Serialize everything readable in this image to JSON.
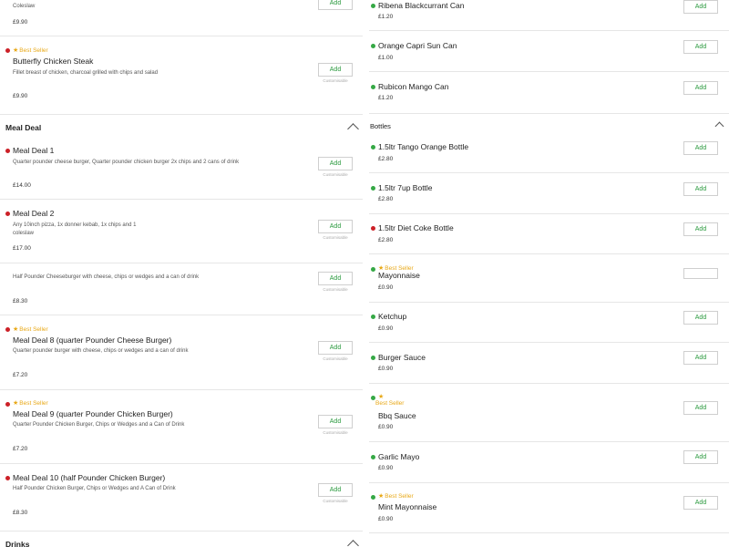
{
  "colors": {
    "veg": "#35a845",
    "nonveg": "#cc2027",
    "bestseller": "#e8a817",
    "add": "#2b9a3f"
  },
  "common": {
    "add_label": "Add",
    "customisable_label": "Customisable",
    "best_seller_label": "Best Seller"
  },
  "left": {
    "top_item": {
      "desc": "Coleslaw",
      "price": "£9.90"
    },
    "butterfly": {
      "name": "Butterfly Chicken Steak",
      "desc": "Fillet breast of chicken, charcoal grilled with chips and salad",
      "price": "£9.90"
    },
    "meal_deal_section": "Meal Deal",
    "meal_deals": [
      {
        "name": "Meal Deal 1",
        "desc": "Quarter pounder cheese burger, Quarter pounder chicken burger 2x chips and 2 cans of drink",
        "price": "£14.00"
      },
      {
        "name": "Meal Deal 2",
        "desc": "Any 10inch pizza, 1x donner kebab, 1x chips and 1 coleslaw",
        "price": "£17.00"
      },
      {
        "name": "",
        "desc": "Half Pounder Cheeseburger with cheese, chips or wedges and a can of drink",
        "price": "£8.30"
      },
      {
        "name": "Meal Deal 8 (quarter Pounder Cheese Burger)",
        "desc": "Quarter pounder burger with cheese, chips or wedges and a can of drink",
        "price": "£7.20"
      },
      {
        "name": "Meal Deal 9 (quarter Pounder Chicken Burger)",
        "desc": "Quarter Pounder Chicken Burger, Chips or Wedges and a Can of Drink",
        "price": "£7.20"
      },
      {
        "name": "Meal Deal 10 (half Pounder Chicken Burger)",
        "desc": "Half Pounder Chicken Burger, Chips or Wedges and A Can of Drink",
        "price": "£8.30"
      }
    ],
    "drinks_section": "Drinks"
  },
  "right": {
    "cans": [
      {
        "name": "Ribena Blackcurrant Can",
        "price": "£1.20"
      },
      {
        "name": "Orange Capri Sun Can",
        "price": "£1.00"
      },
      {
        "name": "Rubicon Mango Can",
        "price": "£1.20"
      }
    ],
    "bottles_section": "Bottles",
    "bottles": [
      {
        "name": "1.5ltr Tango Orange Bottle",
        "price": "£2.80"
      },
      {
        "name": "1.5ltr 7up Bottle",
        "price": "£2.80"
      },
      {
        "name": "1.5ltr Diet Coke Bottle",
        "price": "£2.80"
      }
    ],
    "sauces": [
      {
        "name": "Mayonnaise",
        "price": "£0.90"
      },
      {
        "name": "Ketchup",
        "price": "£0.90"
      },
      {
        "name": "Burger Sauce",
        "price": "£0.90"
      },
      {
        "name": "Bbq Sauce",
        "price": "£0.90"
      },
      {
        "name": "Garlic Mayo",
        "price": "£0.90"
      },
      {
        "name": "Mint Mayonnaise",
        "price": "£0.90"
      }
    ]
  }
}
